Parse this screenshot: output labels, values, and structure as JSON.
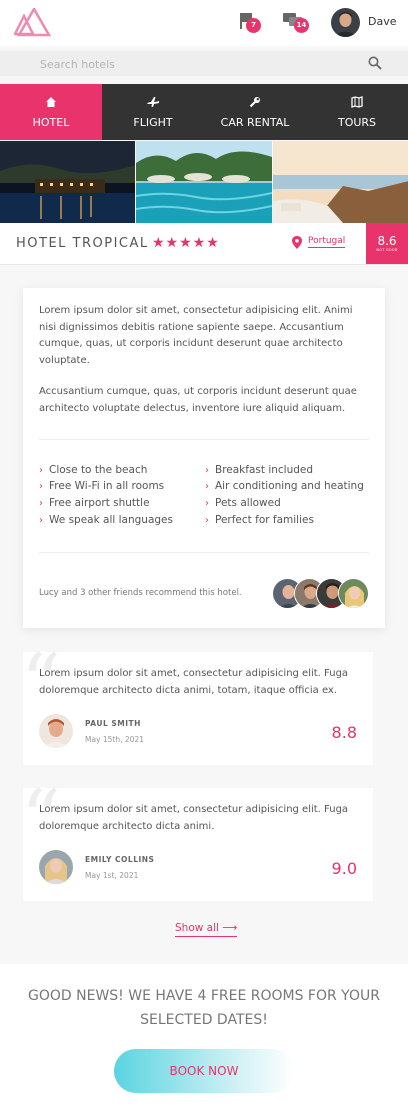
{
  "header": {
    "logo": "triangles-logo",
    "notifications_count": "7",
    "messages_count": "14",
    "user_name": "Dave"
  },
  "search": {
    "placeholder": "Search hotels"
  },
  "tabs": [
    {
      "label": "HOTEL",
      "icon": "home-icon",
      "active": true
    },
    {
      "label": "FLIGHT",
      "icon": "plane-icon",
      "active": false
    },
    {
      "label": "CAR RENTAL",
      "icon": "wrench-icon",
      "active": false
    },
    {
      "label": "TOURS",
      "icon": "map-icon",
      "active": false
    }
  ],
  "hotel": {
    "name": "HOTEL TROPICAL",
    "stars": "★★★★★",
    "location": "Portugal",
    "score": "8.6",
    "score_label": "NOT GOOD"
  },
  "description": {
    "paragraphs": [
      "Lorem ipsum dolor sit amet, consectetur adipisicing elit. Animi nisi dignissimos debitis ratione sapiente saepe. Accusantium cumque, quas, ut corporis incidunt deserunt quae architecto voluptate.",
      "Accusantium cumque, quas, ut corporis incidunt deserunt quae architecto voluptate delectus, inventore iure aliquid aliquam."
    ],
    "features_left": [
      "Close to the beach",
      "Free Wi-Fi in all rooms",
      "Free airport shuttle",
      "We speak all languages"
    ],
    "features_right": [
      "Breakfast included",
      "Air conditioning and heating",
      "Pets allowed",
      "Perfect for families"
    ],
    "recommend": "Lucy and 3 other friends recommend this hotel."
  },
  "reviews": [
    {
      "text": "Lorem ipsum dolor sit amet, consectetur adipisicing elit. Fuga doloremque architecto dicta animi, totam, itaque officia ex.",
      "name": "PAUL SMITH",
      "date": "May 15th, 2021",
      "score": "8.8"
    },
    {
      "text": "Lorem ipsum dolor sit amet, consectetur adipisicing elit. Fuga doloremque architecto dicta animi.",
      "name": "EMILY COLLINS",
      "date": "May 1st, 2021",
      "score": "9.0"
    }
  ],
  "show_all": "Show all  ⟶",
  "promo": {
    "text": "GOOD NEWS! WE HAVE 4 FREE ROOMS FOR YOUR SELECTED DATES!",
    "button": "BOOK NOW"
  },
  "colors": {
    "accent": "#e8336d",
    "dark": "#333333",
    "cta_gradient_start": "#5ad4e0"
  }
}
